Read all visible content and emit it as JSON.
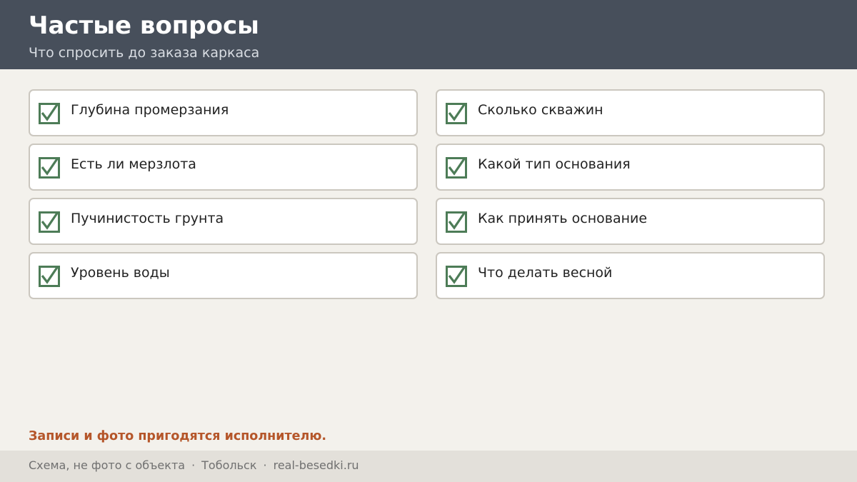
{
  "header": {
    "title": "Частые вопросы",
    "subtitle": "Что спросить до заказа каркаса"
  },
  "items": [
    {
      "label": "Глубина промерзания",
      "checked": true
    },
    {
      "label": "Есть ли мерзлота",
      "checked": true
    },
    {
      "label": "Пучинистость грунта",
      "checked": true
    },
    {
      "label": "Уровень воды",
      "checked": true
    },
    {
      "label": "Сколько скважин",
      "checked": true
    },
    {
      "label": "Какой тип основания",
      "checked": true
    },
    {
      "label": "Как принять основание",
      "checked": true
    },
    {
      "label": "Что делать весной",
      "checked": true
    }
  ],
  "note": "Записи и фото пригодятся исполнителю.",
  "footer": {
    "caption": "Схема, не фото с объекта",
    "separator": "·",
    "city": "Тобольск",
    "site": "real-besedki.ru"
  },
  "colors": {
    "header_bg": "#474f5b",
    "page_bg": "#f3f1ec",
    "check_green": "#4d7c57",
    "note_accent": "#b5562a",
    "footer_bg": "#e3e0da"
  },
  "icons": {
    "check": "checkbox-checked-icon"
  }
}
